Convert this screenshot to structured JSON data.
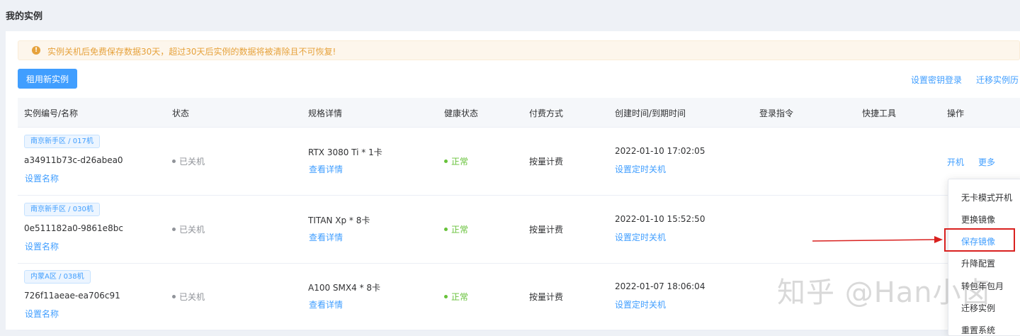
{
  "page": {
    "title": "我的实例"
  },
  "alert": {
    "text": "实例关机后免费保存数据30天，超过30天后实例的数据将被清除且不可恢复!"
  },
  "toolbar": {
    "rent_label": "租用新实例",
    "key_login_label": "设置密钥登录",
    "migrate_history_label": "迁移实例历"
  },
  "table": {
    "headers": [
      "实例编号/名称",
      "状态",
      "规格详情",
      "健康状态",
      "付费方式",
      "创建时间/到期时间",
      "登录指令",
      "快捷工具",
      "操作"
    ],
    "rows": [
      {
        "region": "南京新手区 / 017机",
        "id": "a34911b73c-d26abea0",
        "set_name": "设置名称",
        "status": "已关机",
        "spec": "RTX 3080 Ti * 1卡",
        "spec_detail": "查看详情",
        "health": "正常",
        "billing": "按量计费",
        "created": "2022-01-10 17:02:05",
        "schedule": "设置定时关机",
        "action_start": "开机",
        "action_more": "更多"
      },
      {
        "region": "南京新手区 / 030机",
        "id": "0e511182a0-9861e8bc",
        "set_name": "设置名称",
        "status": "已关机",
        "spec": "TITAN Xp * 8卡",
        "spec_detail": "查看详情",
        "health": "正常",
        "billing": "按量计费",
        "created": "2022-01-10 15:52:50",
        "schedule": "设置定时关机"
      },
      {
        "region": "内蒙A区 / 038机",
        "id": "726f11aeae-ea706c91",
        "set_name": "设置名称",
        "status": "已关机",
        "spec": "A100 SMX4 * 8卡",
        "spec_detail": "查看详情",
        "health": "正常",
        "billing": "按量计费",
        "created": "2022-01-07 18:06:04",
        "schedule": "设置定时关机"
      }
    ]
  },
  "dropdown": {
    "items": [
      "无卡模式开机",
      "更换镜像",
      "保存镜像",
      "升降配置",
      "转包年包月",
      "迁移实例",
      "重置系统"
    ],
    "selected": "保存镜像"
  },
  "watermark": {
    "text": "知乎 @Han小卤"
  },
  "colors": {
    "primary": "#409eff",
    "warning": "#e6a23c",
    "success": "#67c23a",
    "highlight": "#d9211f"
  }
}
